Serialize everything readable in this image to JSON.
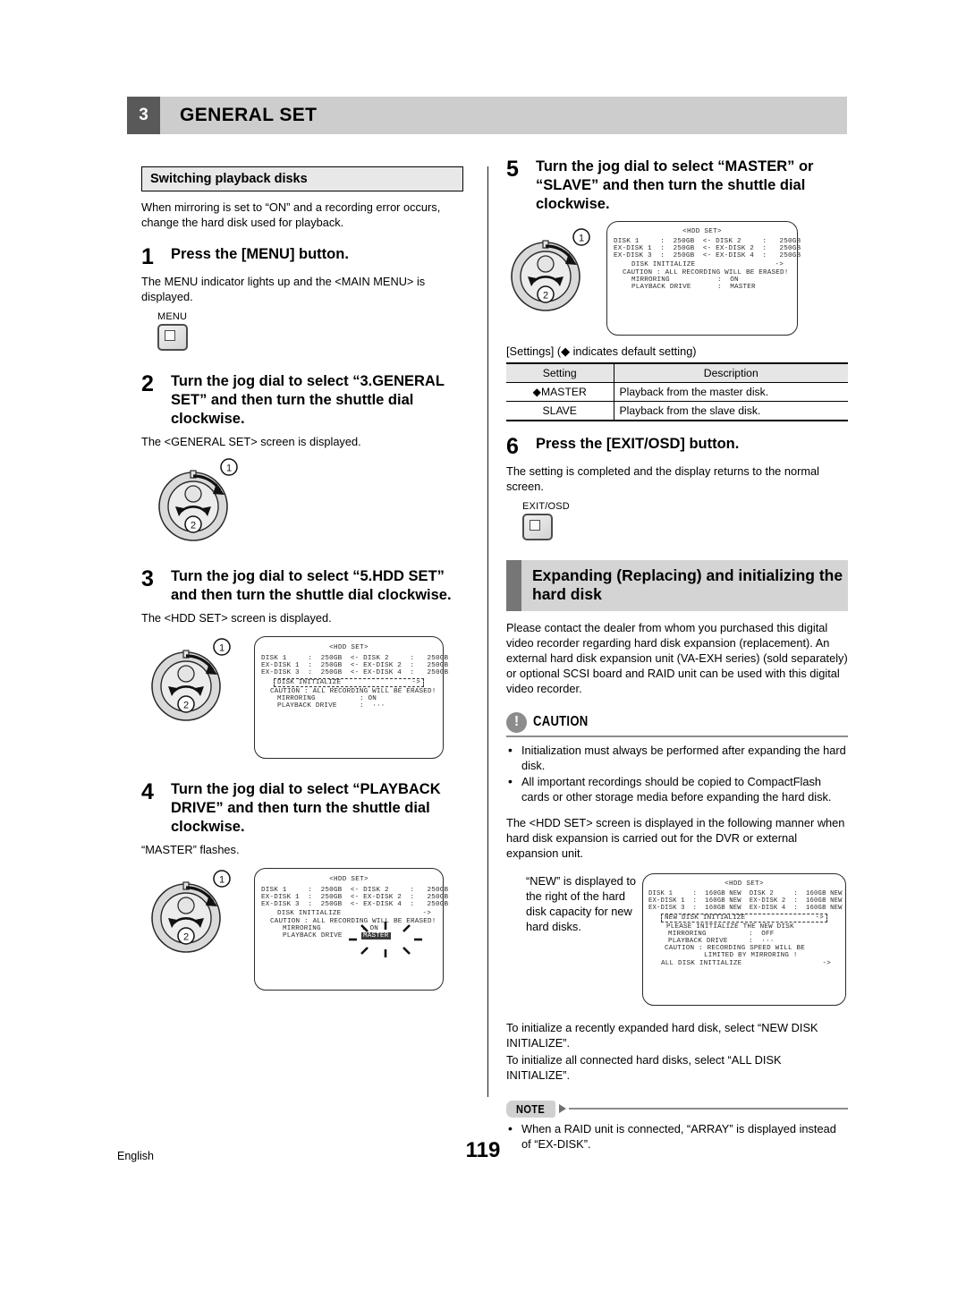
{
  "header": {
    "chapter_number": "3",
    "chapter_title": "GENERAL SET"
  },
  "left_column": {
    "section_heading": "Switching playback disks",
    "intro": "When mirroring is set to “ON” and a recording error occurs, change the hard disk used for playback.",
    "steps": [
      {
        "number": "1",
        "title": "Press the [MENU] button.",
        "note": "The MENU indicator lights up and the <MAIN MENU> is displayed.",
        "button_label": "MENU"
      },
      {
        "number": "2",
        "title": "Turn the jog dial to select “3.GENERAL SET” and then turn the shuttle dial clockwise.",
        "note": "The <GENERAL SET> screen is displayed."
      },
      {
        "number": "3",
        "title": "Turn the jog dial to select “5.HDD SET” and then turn the shuttle dial clockwise.",
        "note": "The <HDD SET> screen is displayed."
      },
      {
        "number": "4",
        "title": "Turn the jog dial to select “PLAYBACK DRIVE” and then turn the shuttle dial clockwise.",
        "note": "“MASTER” flashes."
      }
    ],
    "dial_callout_1": "1",
    "dial_callout_2": "2"
  },
  "osd_step3": {
    "title": "<HDD SET>",
    "rows": [
      "DISK 1     :  250GB  <- DISK 2     :   250GB",
      "EX-DISK 1  :  250GB  <- EX-DISK 2  :   250GB",
      "EX-DISK 3  :  250GB  <- EX-DISK 4  :   250GB"
    ],
    "initialize_label": "DISK INITIALIZE",
    "initialize_arrow": "->",
    "caution": "CAUTION : ALL RECORDING WILL BE ERASED!",
    "mirroring_label": "MIRRORING",
    "mirroring_value": ": ON",
    "playback_label": "PLAYBACK DRIVE",
    "playback_value": ":  ···"
  },
  "osd_step4": {
    "title": "<HDD SET>",
    "rows": [
      "DISK 1     :  250GB  <- DISK 2     :   250GB",
      "EX-DISK 1  :  250GB  <- EX-DISK 2  :   250GB",
      "EX-DISK 3  :  250GB  <- EX-DISK 4  :   250GB"
    ],
    "initialize_label": "DISK INITIALIZE",
    "initialize_arrow": "->",
    "caution": "CAUTION : ALL RECORDING WILL BE ERASED!",
    "mirroring_label": "MIRRORING",
    "mirroring_value": ": ON",
    "playback_label": "PLAYBACK DRIVE",
    "playback_value": "MASTER"
  },
  "right_column": {
    "steps": [
      {
        "number": "5",
        "title": "Turn the jog dial to select “MASTER” or “SLAVE” and then turn the shuttle dial clockwise."
      },
      {
        "number": "6",
        "title": "Press the [EXIT/OSD] button.",
        "note": "The setting is completed and the display returns to the normal screen.",
        "button_label": "EXIT/OSD"
      }
    ],
    "dial_callout_1": "1",
    "dial_callout_2": "2",
    "settings_lead": "[Settings] (◆ indicates default setting)",
    "settings_table": {
      "headers": [
        "Setting",
        "Description"
      ],
      "rows": [
        {
          "setting": "◆MASTER",
          "description": "Playback from the master disk."
        },
        {
          "setting": "SLAVE",
          "description": "Playback from the slave disk."
        }
      ]
    },
    "big_heading": "Expanding (Replacing) and initializing the hard disk",
    "expanding_body": "Please contact the dealer from whom you purchased this digital video recorder regarding hard disk expansion (replacement). An external hard disk expansion unit (VA-EXH series) (sold separately) or optional SCSI board and RAID unit can be used with this digital video recorder.",
    "caution": {
      "label": "CAUTION",
      "icon": "!",
      "items": [
        "Initialization must always be performed after expanding the hard disk.",
        "All important recordings should be copied to CompactFlash cards or other storage media before expanding the hard disk."
      ]
    },
    "hdd_expand_body": "The <HDD SET> screen is displayed in the following manner when hard disk expansion is carried out for the DVR or external expansion unit.",
    "new_caption": "“NEW” is displayed to the right of the hard disk capacity for new hard disks.",
    "init_body_1": "To initialize a recently expanded hard disk, select “NEW DISK INITIALIZE”.",
    "init_body_2": "To initialize all connected hard disks, select “ALL DISK INITIALIZE”.",
    "note": {
      "label": "NOTE",
      "items": [
        "When a RAID unit is connected, “ARRAY” is displayed instead of “EX-DISK”."
      ]
    }
  },
  "osd_step5": {
    "title": "<HDD SET>",
    "rows": [
      "DISK 1     :  250GB  <- DISK 2     :   250GB",
      "EX-DISK 1  :  250GB  <- EX-DISK 2  :   250GB",
      "EX-DISK 3  :  250GB  <- EX-DISK 4  :   250GB"
    ],
    "initialize_label": "DISK INITIALIZE",
    "initialize_arrow": "->",
    "caution": "CAUTION : ALL RECORDING WILL BE ERASED!",
    "mirroring_label": "MIRRORING",
    "mirroring_value": ":  ON",
    "playback_label": "PLAYBACK DRIVE",
    "playback_value": ":  MASTER"
  },
  "osd_newdisk": {
    "title": "<HDD SET>",
    "rows": [
      "DISK 1     :  160GB NEW  DISK 2     :  160GB NEW",
      "EX-DISK 1  :  160GB NEW  EX-DISK 2  :  160GB NEW",
      "EX-DISK 3  :  160GB NEW  EX-DISK 4  :  160GB NEW"
    ],
    "initialize_label": "NEW DISK INITIALIZE",
    "initialize_arrow": "->",
    "please_line": "PLEASE INITIALIZE THE NEW DISK",
    "mirroring_label": "MIRRORING",
    "mirroring_value": ":  OFF",
    "playback_label": "PLAYBACK DRIVE",
    "playback_value": ":  ···",
    "caution_line_1": "CAUTION : RECORDING SPEED WILL BE",
    "caution_line_2": "LIMITED BY MIRRORING !",
    "all_disk_label": "ALL DISK INITIALIZE",
    "all_disk_arrow": "->"
  },
  "footer": {
    "language": "English",
    "page_number": "119"
  }
}
